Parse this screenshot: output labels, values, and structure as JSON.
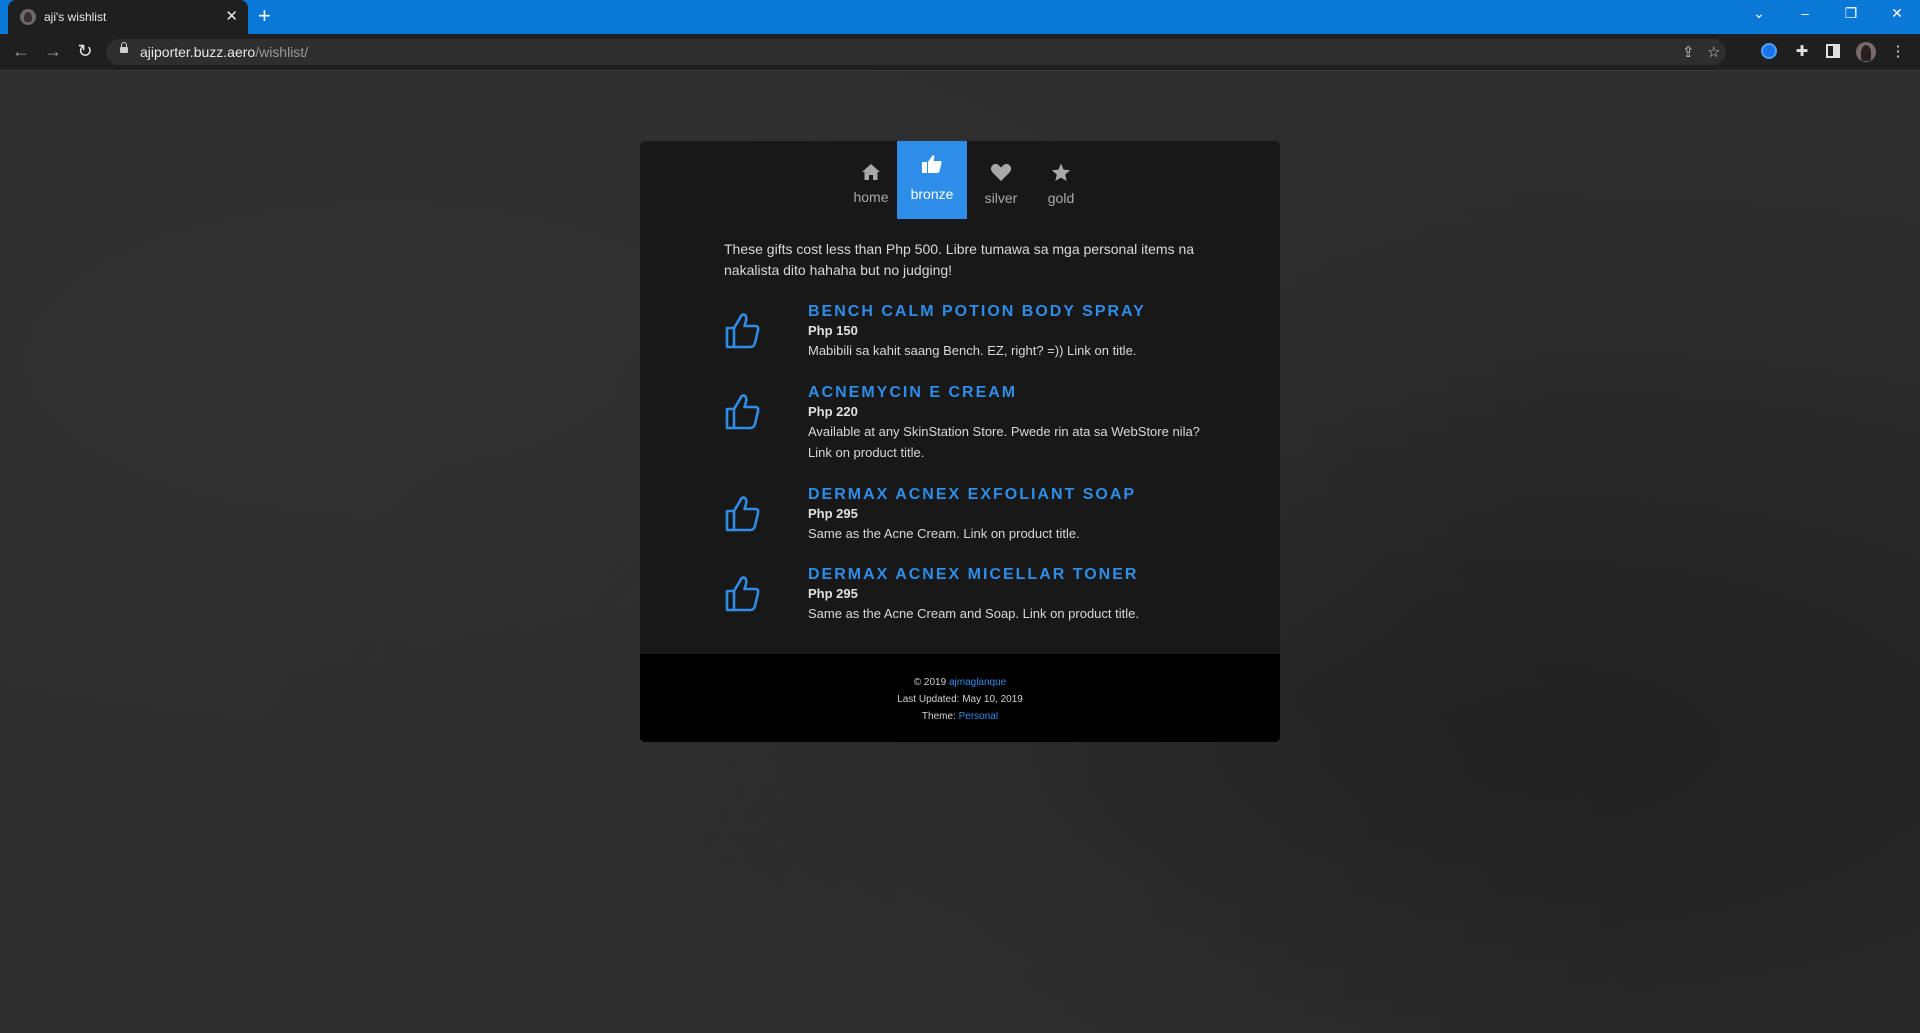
{
  "browser": {
    "tab_title": "aji's wishlist",
    "tab_close": "✕",
    "new_tab": "+",
    "url_host": "ajiporter.buzz.aero",
    "url_path": "/wishlist/",
    "icons": {
      "back": "arrow-left-icon",
      "forward": "arrow-right-icon",
      "reload": "reload-icon",
      "share": "share-icon",
      "bookmark": "star-icon",
      "extensions": "puzzle-icon",
      "menu": "kebab-menu-icon"
    }
  },
  "nav": {
    "items": [
      {
        "label": "home",
        "icon": "home-icon",
        "glyph": "⌂",
        "active": false
      },
      {
        "label": "bronze",
        "icon": "thumbs-up-icon",
        "glyph": "👍",
        "active": true
      },
      {
        "label": "silver",
        "icon": "heart-icon",
        "glyph": "♥",
        "active": false
      },
      {
        "label": "gold",
        "icon": "star-icon",
        "glyph": "★",
        "active": false
      }
    ]
  },
  "intro": "These gifts cost less than Php 500. Libre tumawa sa mga personal items na nakalista dito hahaha but no judging!",
  "items": [
    {
      "title": "Bench Calm Potion Body Spray",
      "price": "Php 150",
      "desc": "Mabibili sa kahit saang Bench. EZ, right? =)) Link on title."
    },
    {
      "title": "Acnemycin E Cream",
      "price": "Php 220",
      "desc": "Available at any SkinStation Store. Pwede rin ata sa WebStore nila? Link on product title."
    },
    {
      "title": "Dermax Acnex Exfoliant Soap",
      "price": "Php 295",
      "desc": "Same as the Acne Cream. Link on product title."
    },
    {
      "title": "Dermax Acnex Micellar Toner",
      "price": "Php 295",
      "desc": "Same as the Acne Cream and Soap. Link on product title."
    }
  ],
  "footer": {
    "copyright_prefix": "© 2019",
    "author": "ajmaglanque",
    "last_updated": "Last Updated: May 10, 2019",
    "theme_prefix": "Theme:",
    "theme": "Personal"
  },
  "colors": {
    "accent": "#2e8de8",
    "chrome_titlebar": "#0a78d7",
    "card_bg": "#181818",
    "footer_bg": "#000000"
  }
}
